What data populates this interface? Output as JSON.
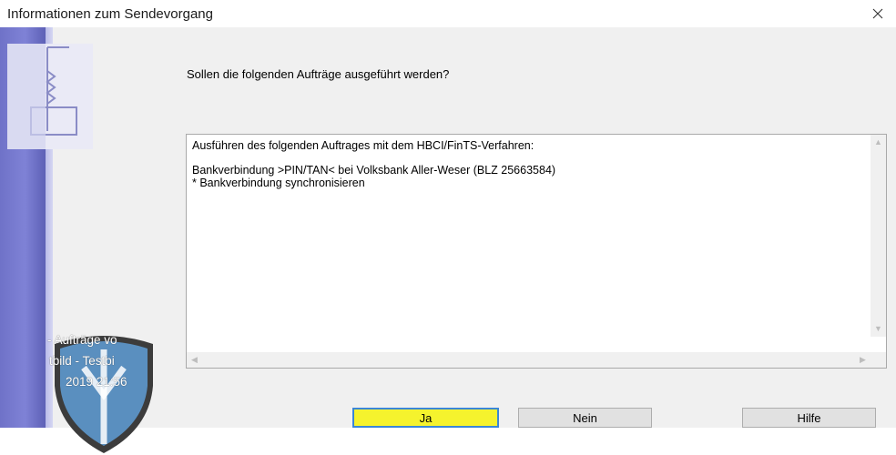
{
  "window": {
    "title": "Informationen zum Sendevorgang",
    "close_symbol": "×"
  },
  "dialog": {
    "question": "Sollen die folgenden Aufträge ausgeführt werden?",
    "details": {
      "lines": [
        "Ausführen des folgenden Auftrages mit dem HBCI/FinTS-Verfahren:",
        "",
        "Bankverbindung >PIN/TAN< bei Volksbank Aller-Weser (BLZ 25663584)",
        "* Bankverbindung synchronisieren"
      ]
    },
    "buttons": {
      "yes": "Ja",
      "no": "Nein",
      "help": "Hilfe"
    }
  },
  "watermark": {
    "lines": [
      "- Aufträge vo",
      "tbild - Testbi",
      "2019 21:56"
    ]
  },
  "icons": {
    "close": "close-icon",
    "logo": "bank-transfer-logo-icon",
    "shield": "shield-badge-icon",
    "scroll_up": "scroll-up-arrow-icon",
    "scroll_down": "scroll-down-arrow-icon",
    "scroll_left": "scroll-left-arrow-icon",
    "scroll_right": "scroll-right-arrow-icon"
  },
  "colors": {
    "sidebar": "#7376cc",
    "default_button": "#f5f32d",
    "default_button_border": "#3a86d6",
    "shield": "#5a8fbf"
  }
}
